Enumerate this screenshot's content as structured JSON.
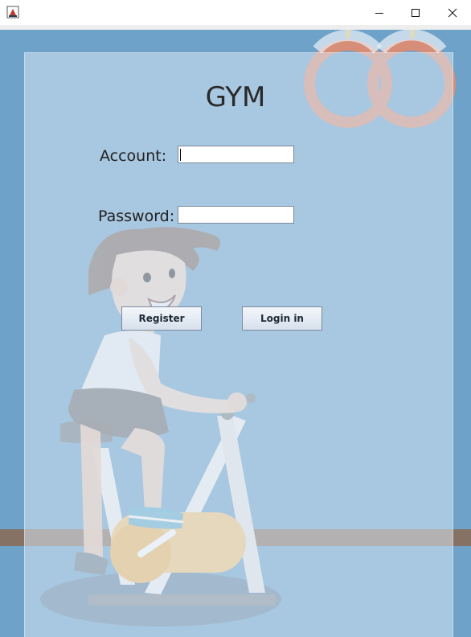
{
  "window": {
    "controls": [
      "minimize-icon",
      "maximize-icon",
      "close-icon"
    ]
  },
  "form": {
    "title": "GYM",
    "account_label": "Account:",
    "account_value": "",
    "password_label": "Password:",
    "password_value": "",
    "register_label": "Register",
    "login_label": "Login in"
  },
  "colors": {
    "background": "#6ea2c9",
    "panel": "#d8e6f2",
    "floor_stripe": "#8a6a52",
    "bike_seat_roller": "#f6c77a"
  }
}
